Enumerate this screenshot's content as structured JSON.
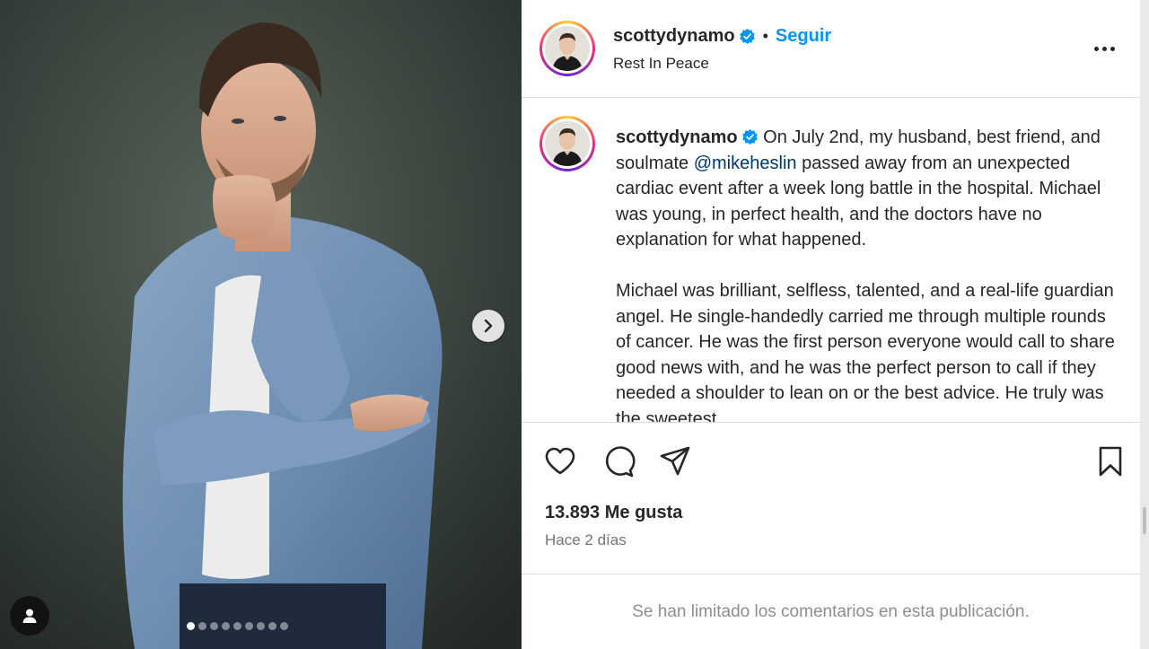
{
  "post": {
    "username": "scottydynamo",
    "follow_label": "Seguir",
    "location": "Rest In Peace",
    "carousel": {
      "total_slides": 9,
      "active_index": 0
    }
  },
  "caption": {
    "username": "scottydynamo",
    "part1": " On July 2nd, my husband, best friend, and soulmate ",
    "mention": "@mikeheslin",
    "part2": " passed away from an unexpected cardiac event after a week long battle in the hospital. Michael was young, in perfect health, and the doctors have no explanation for what happened.",
    "paragraph2": "Michael was brilliant, selfless, talented, and a real-life guardian angel. He single-handedly carried me through multiple rounds of cancer. He was the first person everyone would call to share good news with, and he was the perfect person to call if they needed a shoulder to lean on or the best advice. He truly was the sweetest"
  },
  "stats": {
    "likes": "13.893 Me gusta",
    "time": "Hace 2 días"
  },
  "comments": {
    "limited_notice": "Se han limitado los comentarios en esta publicación."
  },
  "colors": {
    "accent": "#0095f6",
    "mention": "#00376b",
    "verified": "#0095f6"
  },
  "icons": [
    "verified-badge-icon",
    "more-options-icon",
    "like-icon",
    "comment-icon",
    "share-icon",
    "save-icon",
    "next-arrow-icon",
    "tagged-user-icon"
  ]
}
